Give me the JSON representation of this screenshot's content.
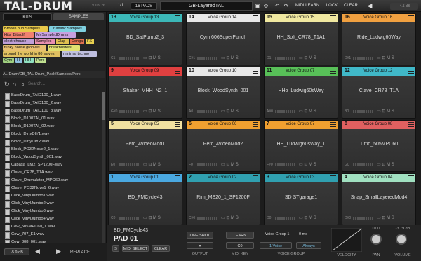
{
  "app": {
    "title": "TAL-DRUM",
    "version": "V 0.9.26"
  },
  "toolbar": {
    "page": "1/1",
    "pads": "16 PADS",
    "preset": "GB-LayeredTAL",
    "midi_learn": "MIDI LEARN",
    "lock": "LOCK",
    "clear": "CLEAR",
    "volume": "-4.5 dB"
  },
  "sidebar": {
    "tab_kits": "KITS",
    "tab_samples": "SAMPLES",
    "tags": [
      {
        "label": "Broken 808 Samples",
        "color": "#e8c84a"
      },
      {
        "label": "Drumatic Samples",
        "color": "#7fd0e0"
      },
      {
        "label": "Hits_Bitwolf",
        "color": "#f08070"
      },
      {
        "label": "MySampledDrums",
        "color": "#c8a0e0"
      },
      {
        "label": "electrohouse",
        "color": "#c0a0d8"
      },
      {
        "label": "Samples",
        "color": "#e890b0"
      },
      {
        "label": "Clap",
        "color": "#e0c050"
      },
      {
        "label": "Conga",
        "color": "#e07050"
      },
      {
        "label": "FX",
        "color": "#e8d050"
      },
      {
        "label": "funky house grooves",
        "color": "#e8c070"
      },
      {
        "label": "breakbusters",
        "color": "#e0e070"
      },
      {
        "label": "around the world in 80 waves",
        "color": "#e0c060"
      },
      {
        "label": "minimal techno",
        "color": "#c0c0e0"
      },
      {
        "label": "Cym",
        "color": "#a0d080"
      },
      {
        "label": "Hi",
        "color": "#90c0e0"
      },
      {
        "label": "HH",
        "color": "#90e0c0"
      },
      {
        "label": "Perc",
        "color": "#c0e090"
      }
    ],
    "path": "AL-Drum/GB_TAL-Drum_Pack/Samples/Perc",
    "search_placeholder": "Search...",
    "files": [
      "BassDrum_TAID100_1.wav",
      "BassDrum_TAID100_2.wav",
      "BassDrum_TAID100_3.wav",
      "Block_D100TAI_01.wav",
      "Block_D100TAI_02.wav",
      "Block_DirtyDIY1.wav",
      "Block_DirtyDIY2.wav",
      "Block_PO32Nove2_1.wav",
      "Block_WoodSynth_001.wav",
      "Cabasa_LM2_SP1200F.wav",
      "Clave_CR78_T1A.wav",
      "Clave_Drumulator_MPC60.wav",
      "Clave_PO32Nove1_6.wav",
      "Click_VinylJumbo1.wav",
      "Click_VinylJumbo2.wav",
      "Click_VinylJumbo3.wav",
      "Click_VinylJumbo4.wav",
      "Cow_505MPC60_1.wav",
      "Cow_707_E1.wav",
      "Cow_808_001.wav"
    ],
    "bottom_volume": "-5.9 dB",
    "replace": "REPLACE"
  },
  "pads": [
    {
      "num": "13",
      "group": "Voice Group 13",
      "name": "BD_SatPump2_3",
      "key": "C1",
      "color": "#3cb8b8"
    },
    {
      "num": "14",
      "group": "Voice Group 14",
      "name": "Cym 606SuperPunch",
      "key": "C#1",
      "color": "#e8e8e8"
    },
    {
      "num": "15",
      "group": "Voice Group 15",
      "name": "HH_Soft_CR78_T1A1",
      "key": "D1",
      "color": "#f0e8a0"
    },
    {
      "num": "16",
      "group": "Voice Group 16",
      "name": "Ride_Ludwig60Way",
      "key": "D#1",
      "color": "#f0a040"
    },
    {
      "num": "9",
      "group": "Voice Group 09",
      "name": "Shaker_MHH_N2_1",
      "key": "G#0",
      "color": "#e04040"
    },
    {
      "num": "10",
      "group": "Voice Group 10",
      "name": "Block_WoodSynth_001",
      "key": "A0",
      "color": "#e8e8e8"
    },
    {
      "num": "11",
      "group": "Voice Group 07",
      "name": "HHo_Ludwig60sWay",
      "key": "A#0",
      "color": "#58c058"
    },
    {
      "num": "12",
      "group": "Voice Group 12",
      "name": "Clave_CR78_T1A",
      "key": "B0",
      "color": "#40b8c8"
    },
    {
      "num": "5",
      "group": "Voice Group 05",
      "name": "Perc_4videoMod1",
      "key": "E0",
      "color": "#f0e0a0"
    },
    {
      "num": "6",
      "group": "Voice Group 06",
      "name": "Perc_4videoMod2",
      "key": "F0",
      "color": "#f0a030"
    },
    {
      "num": "7",
      "group": "Voice Group 07",
      "name": "HH_Ludwig60sWay_1",
      "key": "F#0",
      "color": "#f0a030"
    },
    {
      "num": "8",
      "group": "Voice Group 08",
      "name": "Timb_505MPC60",
      "key": "G0",
      "color": "#e06060"
    },
    {
      "num": "1",
      "group": "Voice Group 01",
      "name": "BD_FMCycle43",
      "key": "C0",
      "color": "#4aa8e0"
    },
    {
      "num": "2",
      "group": "Voice Group 02",
      "name": "Rim_MS20_1_SP1200F",
      "key": "C#0",
      "color": "#30a0b0"
    },
    {
      "num": "3",
      "group": "Voice Group 03",
      "name": "SD STgarage1",
      "key": "D0",
      "color": "#30a0b0"
    },
    {
      "num": "4",
      "group": "Voice Group 04",
      "name": "Snap_SmallLayeredMod4",
      "key": "D#0",
      "color": "#a0e0c0"
    }
  ],
  "bottom": {
    "sample": "BD_FMCycle43",
    "pad": "PAD 01",
    "s": "S",
    "midi_select": "MIDI SELECT",
    "clear": "CLEAR",
    "one_shot": "ONE SHOT",
    "output": "OUTPUT",
    "learn": "LEARN",
    "key": "C0",
    "midi_key": "MIDI KEY",
    "group": "Voice Group 1",
    "ms": "0 ms",
    "voice": "1 Voice",
    "always": "Always",
    "voice_group": "VOICE GROUP",
    "velocity": "VELOCITY",
    "pan_val": "0.00",
    "pan": "PAN",
    "vol_val": "-3.79 dB",
    "volume": "VOLUME"
  }
}
